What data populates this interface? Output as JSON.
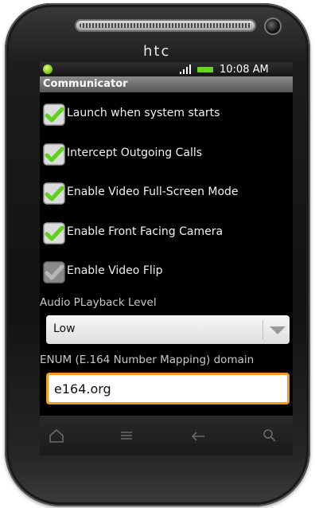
{
  "device": {
    "brand": "htc"
  },
  "status_bar": {
    "time": "10:08 AM"
  },
  "title": "Communicator",
  "preferences": [
    {
      "label": "Launch when system starts",
      "checked": true,
      "enabled": true
    },
    {
      "label": "Intercept Outgoing Calls",
      "checked": true,
      "enabled": true
    },
    {
      "label": "Enable Video Full-Screen Mode",
      "checked": true,
      "enabled": true
    },
    {
      "label": "Enable Front Facing Camera",
      "checked": true,
      "enabled": true
    },
    {
      "label": "Enable Video Flip",
      "checked": true,
      "enabled": false
    }
  ],
  "audio": {
    "label": "Audio PLayback Level",
    "selected": "Low"
  },
  "enum": {
    "label": "ENUM (E.164 Number Mapping) domain",
    "value": "e164.org"
  },
  "nav_buttons": [
    "home-icon",
    "menu-icon",
    "back-icon",
    "search-icon"
  ],
  "colors": {
    "check_green": "#5fd11c",
    "focus_orange": "#f59a25",
    "battery_green": "#6ad41a"
  }
}
